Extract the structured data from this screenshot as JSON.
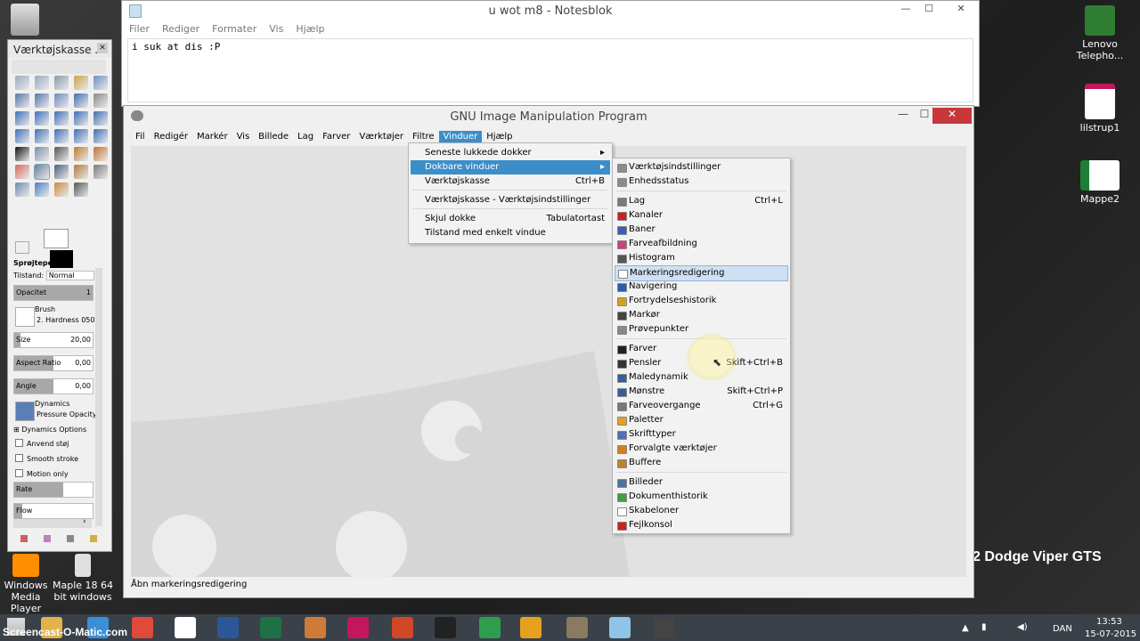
{
  "desktop": {
    "icons": [
      {
        "label": "Lenovo Telepho...",
        "color": "#2e7d32"
      },
      {
        "label": "lilstrup1",
        "color": "#c2185b"
      },
      {
        "label": "Mappe2",
        "color": "#1e7e34"
      },
      {
        "label": "Windows Media Player",
        "color": "#ff8f00"
      },
      {
        "label": "Maple 18 64 bit windows",
        "color": "#e0e0e0"
      }
    ],
    "wallpaper_text": "2 Dodge Viper GTS"
  },
  "notepad": {
    "title": "u wot m8 - Notesblok",
    "menu": [
      "Filer",
      "Rediger",
      "Formater",
      "Vis",
      "Hjælp"
    ],
    "content": "i suk at dis :P"
  },
  "toolbox": {
    "title": "Værktøjskasse ...",
    "options_title": "Sprøjtepensel",
    "mode_label": "Tilstand:",
    "mode_value": "Normal",
    "opacity_label": "Opacitet",
    "opacity_value": "1",
    "brush_label": "Brush",
    "brush_value": "2. Hardness 050",
    "size_label": "Size",
    "size_value": "20,00",
    "aspect_label": "Aspect Ratio",
    "aspect_value": "0,00",
    "angle_label": "Angle",
    "angle_value": "0,00",
    "dynamics_label": "Dynamics",
    "dynamics_value": "Pressure Opacity",
    "dynamics_options": "Dynamics Options",
    "checks": [
      "Anvend støj",
      "Smooth stroke",
      "Motion only"
    ],
    "rate_label": "Rate",
    "flow_label": "Flow"
  },
  "gimp": {
    "title": "GNU Image Manipulation Program",
    "menu": [
      "Fil",
      "Redigér",
      "Markér",
      "Vis",
      "Billede",
      "Lag",
      "Farver",
      "Værktøjer",
      "Filtre",
      "Vinduer",
      "Hjælp"
    ],
    "active_menu": "Vinduer",
    "status": "Åbn markeringsredigering"
  },
  "vinduer_menu": [
    {
      "label": "Seneste lukkede dokker",
      "shortcut": "",
      "arrow": "▸"
    },
    {
      "label": "Dokbare vinduer",
      "shortcut": "",
      "arrow": "▸"
    },
    {
      "label": "Værktøjskasse",
      "shortcut": "Ctrl+B"
    },
    {
      "label": "Værktøjskasse - Værktøjsindstillinger",
      "shortcut": ""
    },
    {
      "label": "Skjul dokke",
      "shortcut": "Tabulatortast"
    },
    {
      "label": "Tilstand med enkelt vindue",
      "shortcut": ""
    }
  ],
  "dockable_menu": [
    {
      "label": "Værktøjsindstillinger",
      "shortcut": "",
      "color": "#8c8c8c"
    },
    {
      "label": "Enhedsstatus",
      "shortcut": "",
      "color": "#8c8c8c"
    },
    {
      "label": "Lag",
      "shortcut": "Ctrl+L",
      "color": "#7a7a7a"
    },
    {
      "label": "Kanaler",
      "shortcut": "",
      "color": "#cc2020"
    },
    {
      "label": "Baner",
      "shortcut": "",
      "color": "#3b5fb0"
    },
    {
      "label": "Farveafbildning",
      "shortcut": "",
      "color": "#d04080"
    },
    {
      "label": "Histogram",
      "shortcut": "",
      "color": "#555555"
    },
    {
      "label": "Markeringsredigering",
      "shortcut": "",
      "color": "#ffffff"
    },
    {
      "label": "Navigering",
      "shortcut": "",
      "color": "#2a5ea8"
    },
    {
      "label": "Fortrydelseshistorik",
      "shortcut": "",
      "color": "#d4a020"
    },
    {
      "label": "Markør",
      "shortcut": "",
      "color": "#444444"
    },
    {
      "label": "Prøvepunkter",
      "shortcut": "",
      "color": "#888888"
    },
    {
      "label": "Farver",
      "shortcut": "",
      "color": "#222222"
    },
    {
      "label": "Pensler",
      "shortcut": "Skift+Ctrl+B",
      "color": "#333333"
    },
    {
      "label": "Maledynamik",
      "shortcut": "",
      "color": "#3060a0"
    },
    {
      "label": "Mønstre",
      "shortcut": "Skift+Ctrl+P",
      "color": "#3a5d9a"
    },
    {
      "label": "Farveovergange",
      "shortcut": "Ctrl+G",
      "color": "#777777"
    },
    {
      "label": "Paletter",
      "shortcut": "",
      "color": "#e0a020"
    },
    {
      "label": "Skrifttyper",
      "shortcut": "",
      "color": "#5070b0"
    },
    {
      "label": "Forvalgte værktøjer",
      "shortcut": "",
      "color": "#d08020"
    },
    {
      "label": "Buffere",
      "shortcut": "",
      "color": "#c08030"
    },
    {
      "label": "Billeder",
      "shortcut": "",
      "color": "#5070a0"
    },
    {
      "label": "Dokumenthistorik",
      "shortcut": "",
      "color": "#40a040"
    },
    {
      "label": "Skabeloner",
      "shortcut": "",
      "color": "#ffffff"
    },
    {
      "label": "Fejlkonsol",
      "shortcut": "",
      "color": "#cc2020"
    }
  ],
  "taskbar": {
    "watermark": "Screencast-O-Matic.com",
    "language": "DAN",
    "time": "13:53",
    "date": "15-07-2015"
  }
}
